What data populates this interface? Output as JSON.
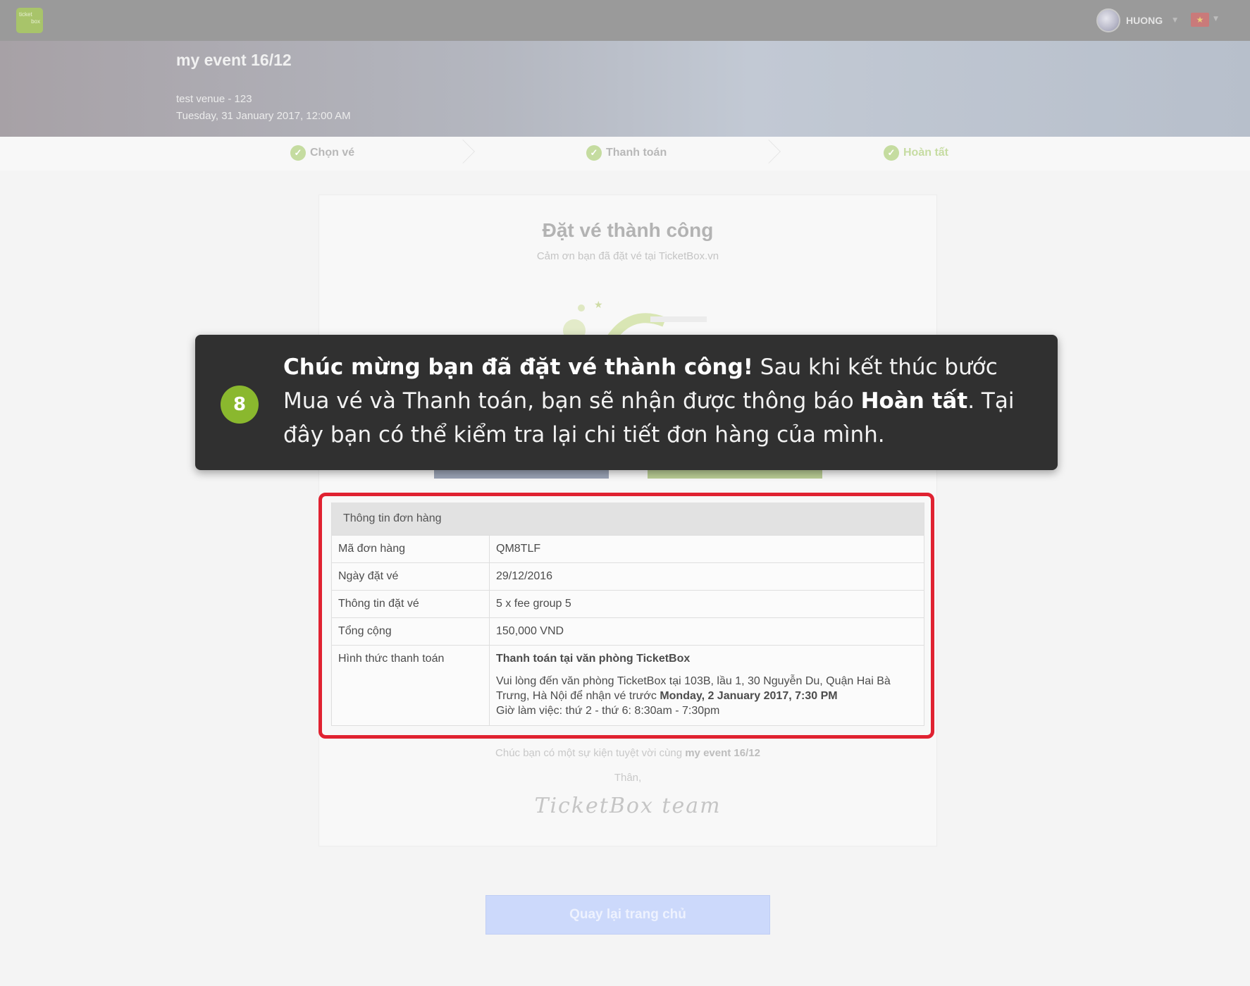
{
  "header": {
    "logo_line1": "ticket",
    "logo_line2": "box",
    "user_name": "HUONG",
    "flag_icon": "vietnam-flag-icon"
  },
  "event": {
    "title": "my event 16/12",
    "venue": "test venue - 123",
    "datetime": "Tuesday, 31 January 2017, 12:00 AM"
  },
  "steps": [
    {
      "label": "Chọn vé"
    },
    {
      "label": "Thanh toán"
    },
    {
      "label": "Hoàn tất"
    }
  ],
  "card": {
    "title": "Đặt vé thành công",
    "subtitle": "Cảm ơn bạn đã đặt vé tại TicketBox.vn"
  },
  "order": {
    "heading": "Thông tin đơn hàng",
    "rows": [
      {
        "key": "Mã đơn hàng",
        "value": "QM8TLF"
      },
      {
        "key": "Ngày đặt vé",
        "value": "29/12/2016"
      },
      {
        "key": "Thông tin đặt vé",
        "value": "5 x fee group 5"
      },
      {
        "key": "Tổng cộng",
        "value": "150,000 VND"
      }
    ],
    "payment_key": "Hình thức thanh toán",
    "payment_title": "Thanh toán tại văn phòng TicketBox",
    "payment_desc_1": "Vui lòng đến văn phòng TicketBox tại 103B, lầu 1, 30 Nguyễn Du, Quận Hai Bà Trưng, Hà Nội để nhận vé trước ",
    "payment_deadline": "Monday, 2 January 2017, 7:30 PM",
    "payment_hours": "Giờ làm việc: thứ 2 - thứ 6:  8:30am - 7:30pm"
  },
  "footer": {
    "wish_prefix": "Chúc bạn có một sự kiện tuyệt vời cùng ",
    "wish_event": "my event 16/12",
    "than": "Thân,",
    "signature": "TicketBox team",
    "home_button": "Quay lại trang chủ"
  },
  "tooltip": {
    "step_number": "8",
    "bold_1": "Chúc mừng bạn đã đặt vé thành công!",
    "text_1": " Sau khi kết thúc bước Mua vé và Thanh toán, bạn sẽ nhận được thông báo ",
    "bold_2": "Hoàn tất",
    "text_2": ". Tại đây bạn có thể kiểm tra lại chi tiết đơn hàng của mình."
  }
}
